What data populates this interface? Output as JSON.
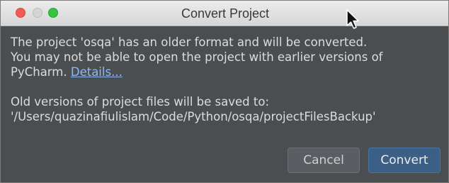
{
  "window": {
    "title": "Convert Project"
  },
  "message": {
    "line1": "The project 'osqa' has an older format and will be converted.",
    "line2": "You may not be able to open the project with earlier versions of",
    "line3_prefix": "PyCharm.",
    "details_link": "Details...",
    "line4": "Old versions of project files will be saved to:",
    "line5": "'/Users/quazinafiulislam/Code/Python/osqa/projectFilesBackup'"
  },
  "buttons": {
    "cancel_label": "Cancel",
    "convert_label": "Convert"
  },
  "colors": {
    "background": "#4b4e51",
    "text": "#dcdcdc",
    "link": "#8fb9f0",
    "primary_button": "#3c5f86",
    "secondary_button": "#5a5e62"
  },
  "icons": {
    "traffic_close": "close-dot-icon",
    "traffic_minimize": "minimize-dot-icon",
    "traffic_maximize": "maximize-dot-icon",
    "cursor": "mouse-pointer-icon"
  }
}
